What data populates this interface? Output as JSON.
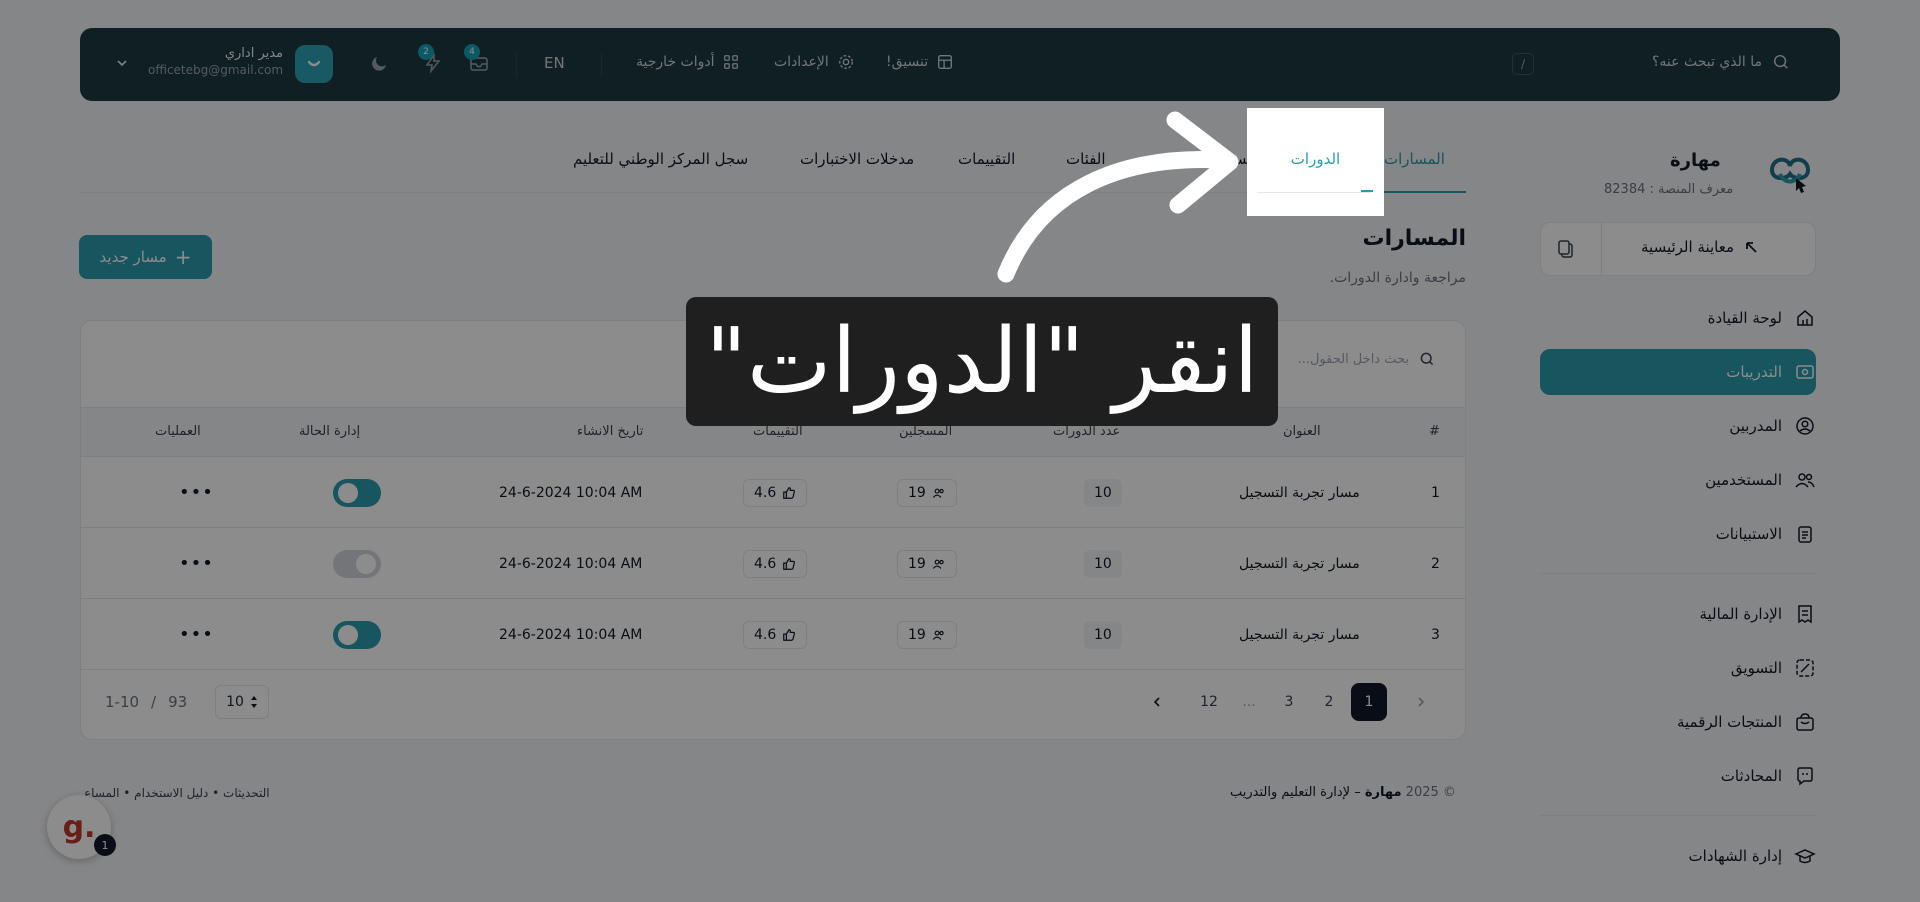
{
  "header": {
    "search_placeholder": "ما الذي تبحث عنه؟",
    "search_shortcut": "/",
    "format_label": "تنسيق!",
    "settings_label": "الإعدادات",
    "external_tools_label": "أدوات خارجية",
    "language": "EN",
    "messages_count": "4",
    "notifications_count": "2",
    "user_name": "مدير اداري",
    "user_email": "officetebg@gmail.com"
  },
  "sidebar": {
    "brand_name": "مهارة",
    "platform_id": "معرف المنصة : 82384",
    "home_preview_label": "معاينة الرئيسية",
    "items": [
      {
        "label": "لوحة القيادة",
        "icon": "home-icon"
      },
      {
        "label": "التدريبات",
        "icon": "training-icon",
        "active": true
      },
      {
        "label": "المدربين",
        "icon": "trainer-icon"
      },
      {
        "label": "المستخدمين",
        "icon": "users-icon"
      },
      {
        "label": "الاستبيانات",
        "icon": "clipboard-icon"
      },
      {
        "label": "الإدارة المالية",
        "icon": "finance-icon"
      },
      {
        "label": "التسويق",
        "icon": "marketing-icon"
      },
      {
        "label": "المنتجات الرقمية",
        "icon": "bag-icon"
      },
      {
        "label": "المحادثات",
        "icon": "chat-icon"
      },
      {
        "label": "إدارة الشهادات",
        "icon": "graduation-icon"
      }
    ]
  },
  "tabs": {
    "paths": "المسارات",
    "courses": "الدورات",
    "partial": "مس",
    "categories": "الفئات",
    "ratings": "التقييمات",
    "exam_entries": "مدخلات الاختبارات",
    "ncel_registry": "سجل المركز الوطني للتعليم"
  },
  "page": {
    "title": "المسارات",
    "subtitle": "مراجعة وادارة الدورات.",
    "new_button": "مسار جديد",
    "search_placeholder": "بحث داخل الحقول..."
  },
  "table": {
    "headers": {
      "index": "#",
      "title": "العنوان",
      "courses_count": "عدد الدورات",
      "enrolled": "المسجلين",
      "ratings": "التقييمات",
      "created_at": "تاريخ الانشاء",
      "status": "إدارة الحالة",
      "actions": "العمليات"
    },
    "rows": [
      {
        "index": "1",
        "title": "مسار تجربة التسجيل",
        "courses": "10",
        "enrolled": "19",
        "rating": "4.6",
        "date": "24-6-2024 10:04 AM",
        "status_on": true
      },
      {
        "index": "2",
        "title": "مسار تجربة التسجيل",
        "courses": "10",
        "enrolled": "19",
        "rating": "4.6",
        "date": "24-6-2024 10:04 AM",
        "status_on": false
      },
      {
        "index": "3",
        "title": "مسار تجربة التسجيل",
        "courses": "10",
        "enrolled": "19",
        "rating": "4.6",
        "date": "24-6-2024 10:04 AM",
        "status_on": true
      }
    ]
  },
  "pagination": {
    "pages": [
      "1",
      "2",
      "3",
      "...",
      "12"
    ],
    "current": "1",
    "per_page": "10",
    "range": "1-10",
    "divider": "/",
    "total": "93"
  },
  "footer": {
    "copyright_year": "© 2025",
    "brand": "مهارة",
    "tagline": "– لإدارة التعليم والتدريب",
    "links": "التحديثات • دليل الاستخدام • المساع"
  },
  "chat_widget": {
    "letter": "g.",
    "count": "1"
  },
  "overlay": {
    "instruction": "انقر \"الدورات\"",
    "highlight_label": "الدورات"
  },
  "colors": {
    "primary": "#2a9bad",
    "header_bg": "#1c3a41",
    "dark": "#111827"
  }
}
